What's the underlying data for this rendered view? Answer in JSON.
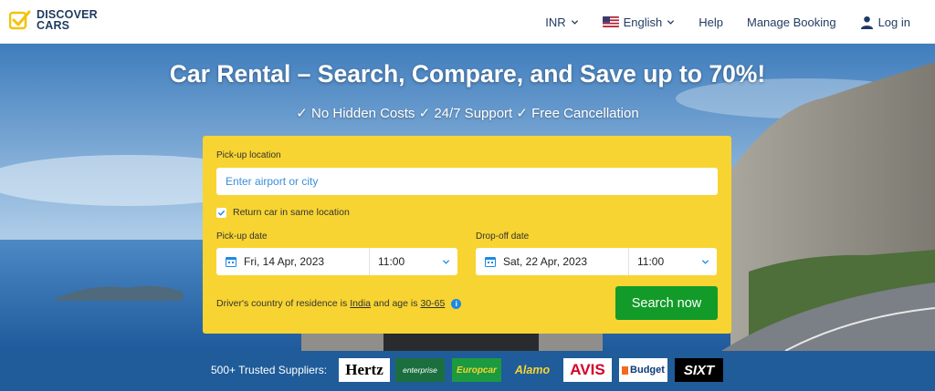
{
  "brand": {
    "name_line1": "DISCOVER",
    "name_line2": "CARS"
  },
  "nav": {
    "currency": "INR",
    "language": "English",
    "help": "Help",
    "manage_booking": "Manage Booking",
    "login": "Log in"
  },
  "hero": {
    "title": "Car Rental – Search, Compare, and Save up to 70%!",
    "subtitle": "✓ No Hidden Costs ✓ 24/7 Support ✓ Free Cancellation"
  },
  "search": {
    "pickup_location_label": "Pick-up location",
    "pickup_location_placeholder": "Enter airport or city",
    "return_same_label": "Return car in same location",
    "return_same_checked": true,
    "pickup_date_label": "Pick-up date",
    "pickup_date": "Fri, 14 Apr, 2023",
    "pickup_time": "11:00",
    "dropoff_date_label": "Drop-off date",
    "dropoff_date": "Sat, 22 Apr, 2023",
    "dropoff_time": "11:00",
    "residence_prefix": "Driver's country of residence is",
    "residence_country": "India",
    "residence_mid": "and age is",
    "residence_age": "30-65",
    "search_button": "Search now"
  },
  "suppliers": {
    "label": "500+ Trusted Suppliers:",
    "brands": [
      "Hertz",
      "enterprise",
      "Europcar",
      "Alamo",
      "AVIS",
      "Budget",
      "SIXT"
    ]
  },
  "colors": {
    "navy": "#1e3a5f",
    "panel_yellow": "#f7d431",
    "search_green": "#129b29",
    "band_blue": "#1f5c99",
    "link_blue": "#3a8fd9"
  }
}
